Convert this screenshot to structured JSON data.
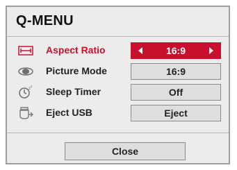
{
  "menu": {
    "title": "Q-MENU",
    "accent_color": "#c8102e",
    "items": [
      {
        "icon": "aspect-ratio-icon",
        "label": "Aspect Ratio",
        "value": "16:9",
        "selected": true
      },
      {
        "icon": "picture-mode-icon",
        "label": "Picture Mode",
        "value": "16:9",
        "selected": false
      },
      {
        "icon": "sleep-timer-icon",
        "label": "Sleep Timer",
        "value": "Off",
        "selected": false
      },
      {
        "icon": "eject-usb-icon",
        "label": "Eject USB",
        "value": "Eject",
        "selected": false
      }
    ],
    "close_label": "Close"
  }
}
